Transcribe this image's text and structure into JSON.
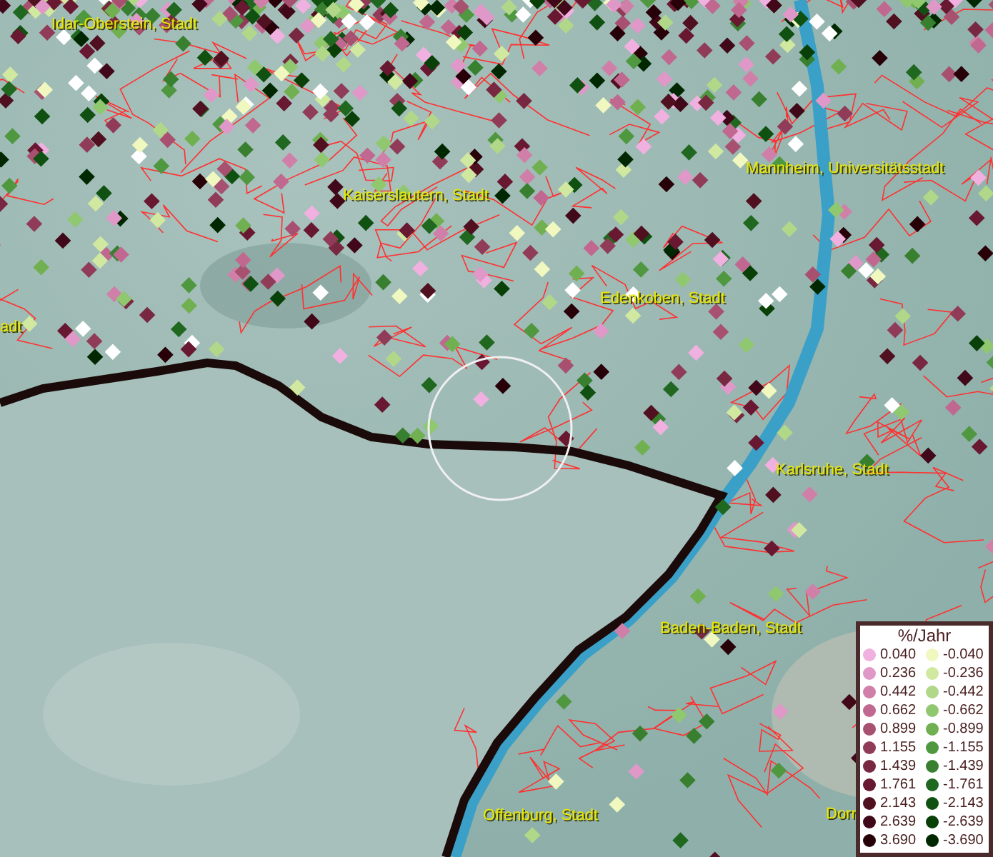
{
  "map_labels": [
    {
      "text": "Idar-Oberstein, Stadt"
    },
    {
      "text": "Kaiserslautern, Stadt"
    },
    {
      "text": "Mannheim, Universitätsstadt"
    },
    {
      "text": "adt"
    },
    {
      "text": "Edenkoben, Stadt"
    },
    {
      "text": "Karlsruhe, Stadt"
    },
    {
      "text": "Baden-Baden, Stadt"
    },
    {
      "text": "Offenburg, Stadt"
    },
    {
      "text": "Dorr"
    }
  ],
  "legend": {
    "title": "%/Jahr",
    "entries": [
      {
        "label": "0.040",
        "color": "#f0b0e0"
      },
      {
        "label": "-0.040",
        "color": "#f0f8c0"
      },
      {
        "label": "0.236",
        "color": "#e098c8"
      },
      {
        "label": "-0.236",
        "color": "#d0e8a0"
      },
      {
        "label": "0.442",
        "color": "#d080a8"
      },
      {
        "label": "-0.442",
        "color": "#b0d888"
      },
      {
        "label": "0.662",
        "color": "#c06890"
      },
      {
        "label": "-0.662",
        "color": "#90c870"
      },
      {
        "label": "0.899",
        "color": "#a85070"
      },
      {
        "label": "-0.899",
        "color": "#70b050"
      },
      {
        "label": "1.155",
        "color": "#903c58"
      },
      {
        "label": "-1.155",
        "color": "#509840"
      },
      {
        "label": "1.439",
        "color": "#782840"
      },
      {
        "label": "-1.439",
        "color": "#388030"
      },
      {
        "label": "1.761",
        "color": "#681830"
      },
      {
        "label": "-1.761",
        "color": "#206820"
      },
      {
        "label": "2.143",
        "color": "#501020"
      },
      {
        "label": "-2.143",
        "color": "#105010"
      },
      {
        "label": "2.639",
        "color": "#400818"
      },
      {
        "label": "-2.639",
        "color": "#084008"
      },
      {
        "label": "3.690",
        "color": "#280008"
      },
      {
        "label": "-3.690",
        "color": "#002800"
      }
    ]
  }
}
